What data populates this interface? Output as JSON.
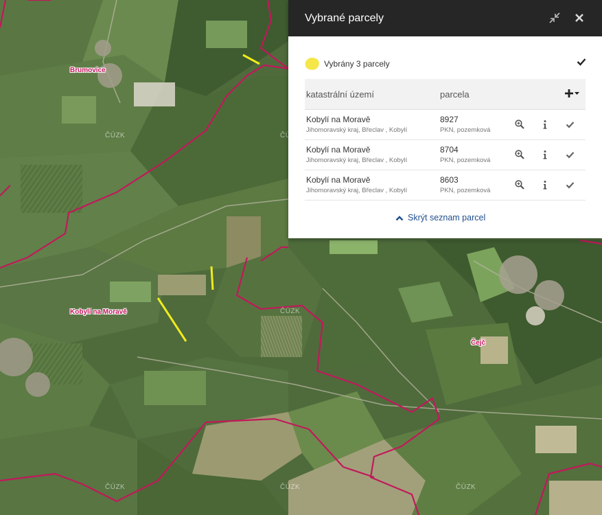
{
  "panel": {
    "title": "Vybrané parcely",
    "summary": "Vybrány 3 parcely",
    "columns": {
      "area": "katastrální území",
      "parcel": "parcela"
    },
    "rows": [
      {
        "name": "Kobylí na Moravě",
        "region": "Jihomoravský kraj, Břeclav , Kobylí",
        "number": "8927",
        "type": "PKN, pozemková"
      },
      {
        "name": "Kobylí na Moravě",
        "region": "Jihomoravský kraj, Břeclav , Kobylí",
        "number": "8704",
        "type": "PKN, pozemková"
      },
      {
        "name": "Kobylí na Moravě",
        "region": "Jihomoravský kraj, Břeclav , Kobylí",
        "number": "8603",
        "type": "PKN, pozemková"
      }
    ],
    "toggle_label": "Skrýt seznam parcel",
    "highlight_color": "#f5e64a"
  },
  "map": {
    "towns": [
      "Brumovice",
      "Kobylí na Moravě",
      "Čejč"
    ],
    "watermark": "ČÚZK",
    "boundary_color": "#c2185b",
    "parcel_color": "#f0ec1c"
  }
}
